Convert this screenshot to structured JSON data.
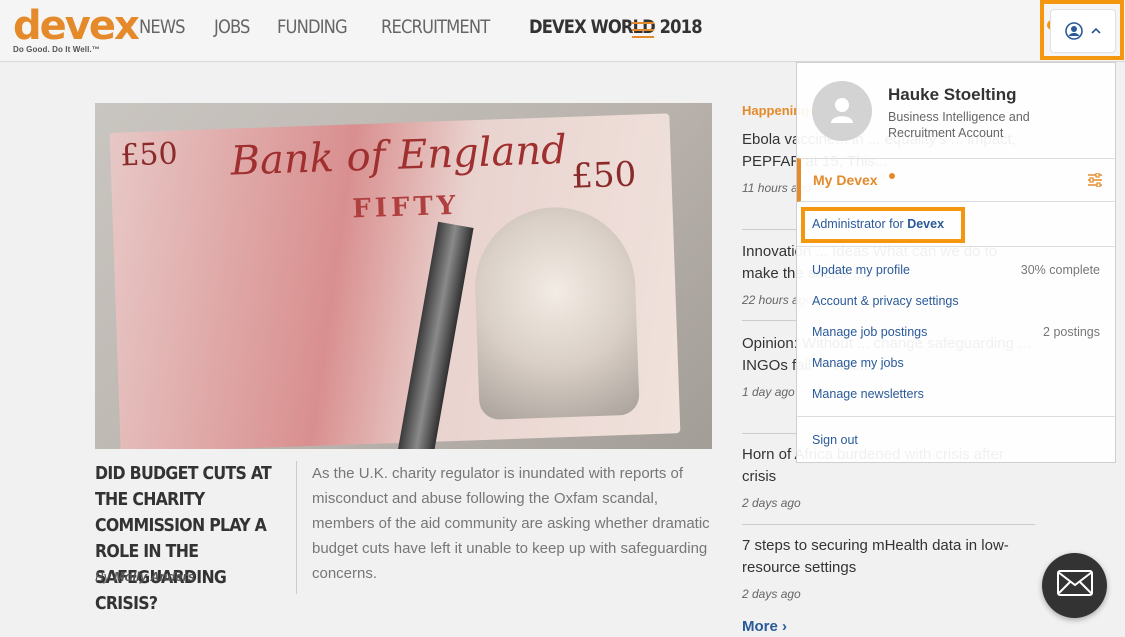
{
  "brand": {
    "logo_text": "devex",
    "tagline": "Do Good. Do It Well.™"
  },
  "nav": {
    "items": [
      "NEWS",
      "JOBS",
      "FUNDING",
      "RECRUITMENT",
      "DEVEX WORLD 2018"
    ]
  },
  "colors": {
    "accent": "#e58a2b",
    "highlight": "#f5960f",
    "link": "#2a5a9a"
  },
  "feature": {
    "title": "DID BUDGET CUTS AT THE CHARITY COMMISSION PLAY A ROLE IN THE SAFEGUARDING CRISIS?",
    "byline_prefix": "By",
    "author": "Molly Anders",
    "summary": "As the U.K. charity regulator is inundated with reports of misconduct and abuse following the Oxfam scandal, members of the aid community are asking whether dramatic budget cuts have left it unable to keep up with safeguarding concerns."
  },
  "sidebar": {
    "heading": "Happening",
    "stories": [
      {
        "title": "Ebola vaccine... in ... equality's ... impact, PEPFAR at 15, This...",
        "time": "11 hours ago"
      },
      {
        "title": "Innovation ... Ideas What can we do to make the sector ...",
        "time": "22 hours ago"
      },
      {
        "title": "Opinion: Without ... change safeguarding ... INGOs fail — not...",
        "time": "1 day ago"
      },
      {
        "title": "Horn of Africa burdened with crisis after crisis",
        "time": "2 days ago"
      },
      {
        "title": "7 steps to securing mHealth data in low-resource settings",
        "time": "2 days ago"
      }
    ],
    "more_label": "More ›"
  },
  "user_menu": {
    "name": "Hauke Stoelting",
    "role": "Business Intelligence and Recruitment Account",
    "my_devex_label": "My Devex",
    "admin_prefix": "Administrator for",
    "admin_org": "Devex",
    "links": [
      {
        "label": "Update my profile",
        "meta": "30% complete"
      },
      {
        "label": "Account & privacy settings",
        "meta": ""
      },
      {
        "label": "Manage job postings",
        "meta": "2 postings"
      },
      {
        "label": "Manage my jobs",
        "meta": ""
      },
      {
        "label": "Manage newsletters",
        "meta": ""
      }
    ],
    "sign_out": "Sign out"
  },
  "icons": {
    "user": "user-circle-icon",
    "chevron": "chevron-up-icon",
    "menu": "hamburger-icon",
    "settings": "sliders-icon",
    "mail": "envelope-icon"
  }
}
